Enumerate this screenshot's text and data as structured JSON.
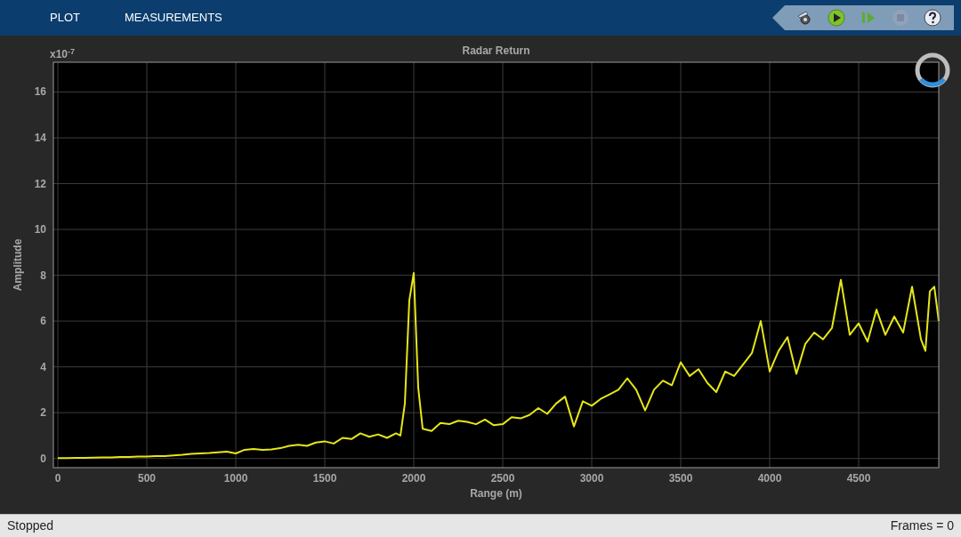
{
  "toolbar": {
    "tabs": [
      {
        "label": "PLOT"
      },
      {
        "label": "MEASUREMENTS"
      }
    ],
    "controls": [
      {
        "kind": "settings",
        "disabled": false
      },
      {
        "kind": "run",
        "disabled": false
      },
      {
        "kind": "step",
        "disabled": false
      },
      {
        "kind": "stop",
        "disabled": true
      },
      {
        "kind": "help",
        "disabled": false
      }
    ]
  },
  "chart": {
    "exponent": "x10$^{-7}$",
    "chart_data": {
      "type": "line",
      "title": "Radar Return",
      "xlabel": "Range (m)",
      "ylabel": "Amplitude",
      "x": [
        0,
        50,
        100,
        150,
        200,
        250,
        300,
        350,
        400,
        450,
        500,
        550,
        600,
        650,
        700,
        750,
        800,
        850,
        900,
        950,
        1000,
        1050,
        1100,
        1150,
        1200,
        1250,
        1300,
        1350,
        1400,
        1450,
        1500,
        1550,
        1600,
        1650,
        1700,
        1750,
        1800,
        1850,
        1900,
        1925,
        1950,
        1975,
        2000,
        2025,
        2050,
        2100,
        2150,
        2200,
        2250,
        2300,
        2350,
        2400,
        2450,
        2500,
        2550,
        2600,
        2650,
        2700,
        2750,
        2800,
        2850,
        2900,
        2950,
        3000,
        3050,
        3100,
        3150,
        3200,
        3250,
        3300,
        3350,
        3400,
        3450,
        3500,
        3550,
        3600,
        3650,
        3700,
        3750,
        3800,
        3850,
        3900,
        3950,
        4000,
        4050,
        4100,
        4150,
        4200,
        4250,
        4300,
        4350,
        4400,
        4450,
        4500,
        4550,
        4600,
        4650,
        4700,
        4750,
        4800,
        4850,
        4875,
        4900,
        4925,
        4950
      ],
      "series": [
        {
          "color": "#e6e619",
          "values": [
            0.02,
            0.02,
            0.03,
            0.03,
            0.04,
            0.05,
            0.05,
            0.06,
            0.07,
            0.08,
            0.09,
            0.1,
            0.11,
            0.13,
            0.16,
            0.2,
            0.22,
            0.24,
            0.27,
            0.3,
            0.22,
            0.38,
            0.42,
            0.38,
            0.4,
            0.45,
            0.55,
            0.6,
            0.55,
            0.7,
            0.75,
            0.65,
            0.9,
            0.85,
            1.1,
            0.95,
            1.05,
            0.9,
            1.1,
            1.0,
            2.4,
            6.9,
            8.1,
            3.1,
            1.3,
            1.2,
            1.55,
            1.5,
            1.65,
            1.6,
            1.5,
            1.7,
            1.45,
            1.5,
            1.8,
            1.75,
            1.9,
            2.2,
            1.95,
            2.4,
            2.7,
            1.4,
            2.5,
            2.3,
            2.6,
            2.8,
            3.0,
            3.5,
            3.0,
            2.1,
            3.0,
            3.4,
            3.2,
            4.2,
            3.6,
            3.9,
            3.3,
            2.9,
            3.8,
            3.6,
            4.1,
            4.6,
            6.0,
            3.8,
            4.7,
            5.3,
            3.7,
            5.0,
            5.5,
            5.2,
            5.7,
            7.8,
            5.4,
            5.9,
            5.1,
            6.5,
            5.4,
            6.2,
            5.5,
            7.5,
            5.2,
            4.7,
            7.3,
            7.5,
            6.0
          ]
        }
      ],
      "xlim": [
        -25,
        4950
      ],
      "ylim": [
        -0.4,
        17.3
      ],
      "xticks": [
        0,
        500,
        1000,
        1500,
        2000,
        2500,
        3000,
        3500,
        4000,
        4500
      ],
      "yticks": [
        0,
        2,
        4,
        6,
        8,
        10,
        12,
        14,
        16
      ],
      "grid": true
    }
  },
  "status_bar": {
    "state": "Stopped",
    "frames": "Frames = 0"
  }
}
